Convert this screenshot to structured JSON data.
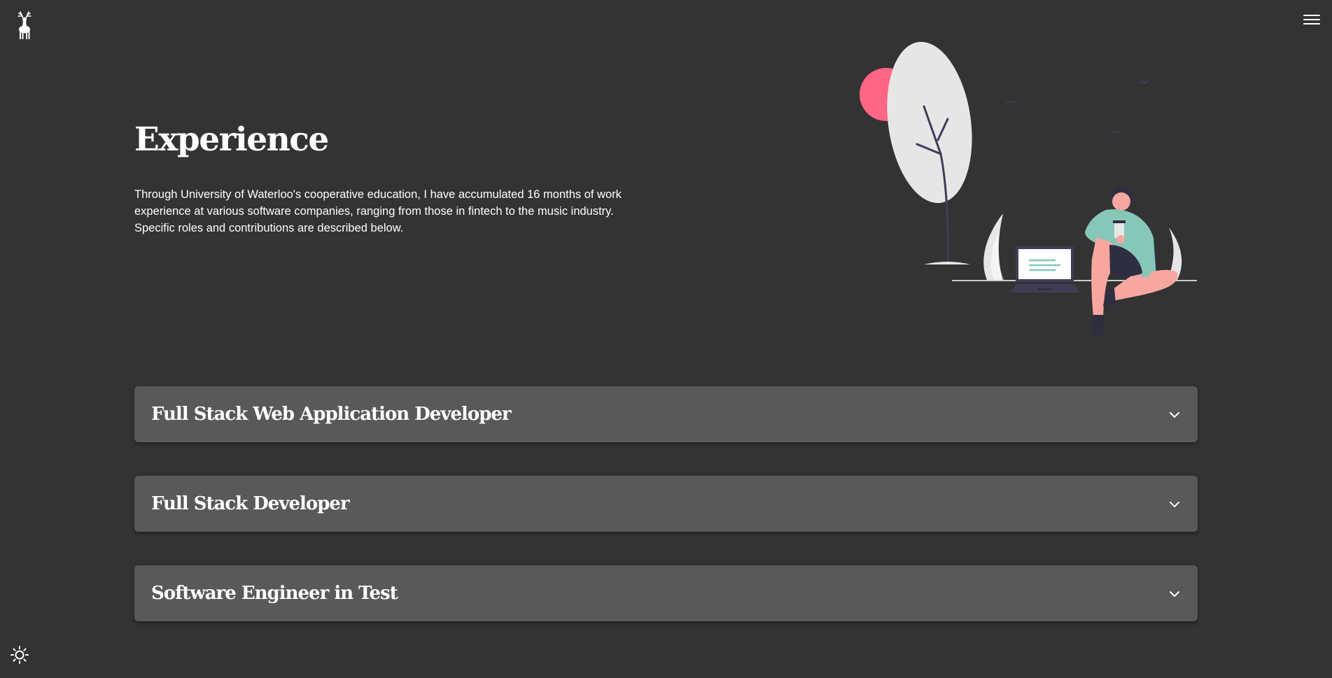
{
  "header": {
    "logo_icon": "deer-logo-icon",
    "menu_icon": "hamburger-menu-icon"
  },
  "hero": {
    "title": "Experience",
    "intro": "Through University of Waterloo's cooperative education, I have accumulated 16 months of work experience at various software companies, ranging from those in fintech to the music industry. Specific roles and contributions are described below."
  },
  "experience": {
    "items": [
      {
        "label": "Full Stack Web Application Developer"
      },
      {
        "label": "Full Stack Developer"
      },
      {
        "label": "Software Engineer in Test"
      }
    ]
  },
  "footer": {
    "theme_icon": "sun-icon"
  },
  "colors": {
    "background": "#333333",
    "card": "#595959",
    "accent_pink": "#ff6584",
    "accent_teal": "#86c7b8",
    "skin": "#f7a6a0"
  }
}
